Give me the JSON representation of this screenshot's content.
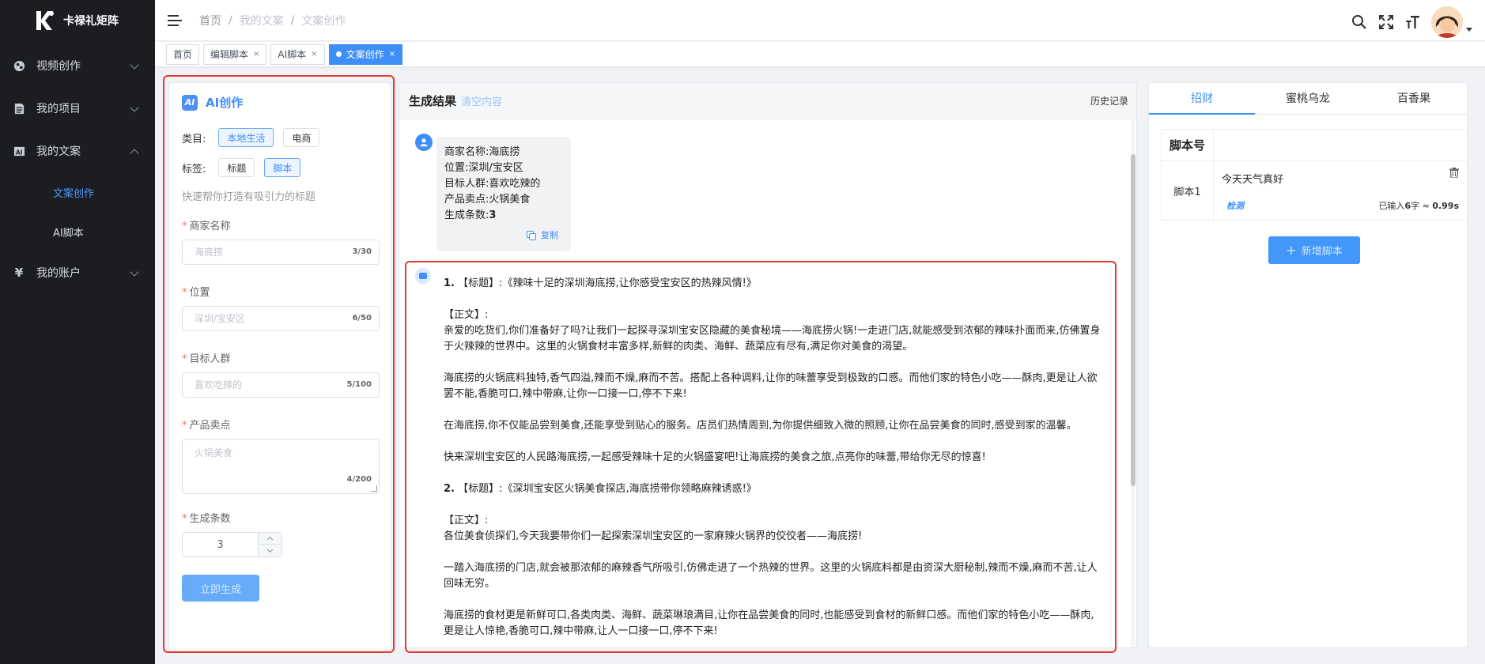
{
  "app": {
    "name": "卡禄礼矩阵"
  },
  "sidebar": {
    "items": [
      {
        "label": "视频创作",
        "icon": "globe-icon"
      },
      {
        "label": "我的项目",
        "icon": "document-icon"
      },
      {
        "label": "我的文案",
        "icon": "ai-text-icon",
        "expanded": true,
        "children": [
          {
            "label": "文案创作",
            "active": true
          },
          {
            "label": "AI脚本"
          }
        ]
      },
      {
        "label": "我的账户",
        "icon": "yen-icon"
      }
    ]
  },
  "breadcrumb": [
    "首页",
    "我的文案",
    "文案创作"
  ],
  "tabs": [
    {
      "label": "首页",
      "closable": false
    },
    {
      "label": "编辑脚本",
      "closable": true
    },
    {
      "label": "AI脚本",
      "closable": true
    },
    {
      "label": "文案创作",
      "closable": true,
      "active": true
    }
  ],
  "form": {
    "title": "AI创作",
    "badge": "AI",
    "category_label": "类目:",
    "categories": [
      {
        "label": "本地生活",
        "selected": true
      },
      {
        "label": "电商",
        "selected": false
      }
    ],
    "tag_label": "标签:",
    "tag_options": [
      {
        "label": "标题",
        "selected": false
      },
      {
        "label": "脚本",
        "selected": true
      }
    ],
    "hint": "快速帮你打造有吸引力的标题",
    "fields": {
      "merchant": {
        "label": "商家名称",
        "placeholder": "海底捞",
        "count": "3/30"
      },
      "location": {
        "label": "位置",
        "placeholder": "深圳/宝安区",
        "count": "6/50"
      },
      "audience": {
        "label": "目标人群",
        "placeholder": "喜欢吃辣的",
        "count": "5/100"
      },
      "selling": {
        "label": "产品卖点",
        "placeholder": "火锅美食",
        "count": "4/200"
      },
      "quantity": {
        "label": "生成条数",
        "value": "3"
      }
    },
    "submit_label": "立即生成"
  },
  "result": {
    "title": "生成结果",
    "clear_label": "清空内容",
    "history_label": "历史记录",
    "copy_label": "复制",
    "request": {
      "merchant": "商家名称:海底捞",
      "location": "位置:深圳/宝安区",
      "audience": "目标人群:喜欢吃辣的",
      "selling": "产品卖点:火锅美食",
      "count_label": "生成条数:",
      "count_value": "3"
    },
    "paragraphs": [
      {
        "num": "1.",
        "text": "【标题】:《辣味十足的深圳海底捞,让你感受宝安区的热辣风情!》"
      },
      {
        "text": "【正文】:"
      },
      {
        "text": "亲爱的吃货们,你们准备好了吗?让我们一起探寻深圳宝安区隐藏的美食秘境——海底捞火锅!一走进门店,就能感受到浓郁的辣味扑面而来,仿佛置身于火辣辣的世界中。这里的火锅食材丰富多样,新鲜的肉类、海鲜、蔬菜应有尽有,满足你对美食的渴望。"
      },
      {
        "text": "海底捞的火锅底料独特,香气四溢,辣而不燥,麻而不苦。搭配上各种调料,让你的味蕾享受到极致的口感。而他们家的特色小吃——酥肉,更是让人欲罢不能,香脆可口,辣中带麻,让你一口接一口,停不下来!"
      },
      {
        "text": "在海底捞,你不仅能品尝到美食,还能享受到贴心的服务。店员们热情周到,为你提供细致入微的照顾,让你在品尝美食的同时,感受到家的温馨。"
      },
      {
        "text": "快来深圳宝安区的人民路海底捞,一起感受辣味十足的火锅盛宴吧!让海底捞的美食之旅,点亮你的味蕾,带给你无尽的惊喜!"
      },
      {
        "num": "2.",
        "text": "【标题】:《深圳宝安区火锅美食探店,海底捞带你领略麻辣诱惑!》"
      },
      {
        "text": "【正文】:"
      },
      {
        "text": "各位美食侦探们,今天我要带你们一起探索深圳宝安区的一家麻辣火锅界的佼佼者——海底捞!"
      },
      {
        "text": "一踏入海底捞的门店,就会被那浓郁的麻辣香气所吸引,仿佛走进了一个热辣的世界。这里的火锅底料都是由资深大厨秘制,辣而不燥,麻而不苦,让人回味无穷。"
      },
      {
        "text": "海底捞的食材更是新鲜可口,各类肉类、海鲜、蔬菜琳琅满目,让你在品尝美食的同时,也能感受到食材的新鲜口感。而他们家的特色小吃——酥肉,更是让人惊艳,香脆可口,辣中带麻,让人一口接一口,停不下来!"
      }
    ]
  },
  "scripts": {
    "tabs": [
      {
        "label": "招财",
        "active": true
      },
      {
        "label": "蜜桃乌龙"
      },
      {
        "label": "百香果"
      }
    ],
    "header": "脚本号",
    "rows": [
      {
        "name": "脚本1",
        "content": "今天天气真好",
        "check_label": "检测",
        "wc_prefix": "已输入",
        "wc_num": "6",
        "wc_mid": "字 ≈ ",
        "wc_time": "0.99s"
      }
    ],
    "add_label": "新增脚本"
  }
}
